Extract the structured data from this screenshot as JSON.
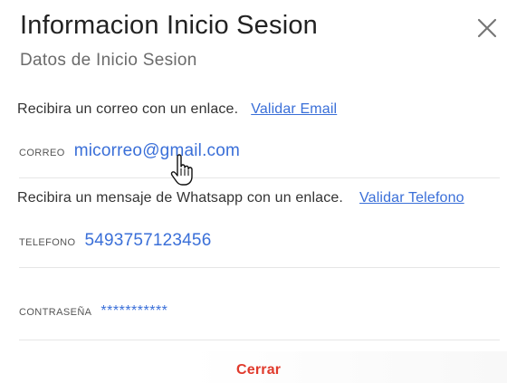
{
  "header": {
    "title": "Informacion Inicio Sesion",
    "subtitle": "Datos de Inicio Sesion",
    "close_icon": "close-icon"
  },
  "email_section": {
    "info_text": "Recibira un correo con un enlace.",
    "validate_link": "Validar Email",
    "label": "CORREO",
    "value": "micorreo@gmail.com"
  },
  "phone_section": {
    "info_text": "Recibira un mensaje de Whatsapp con un enlace.",
    "validate_link": "Validar Telefono",
    "label": "TELEFONO",
    "value": "5493757123456"
  },
  "password_section": {
    "label": "CONTRASEÑA",
    "value": "***********"
  },
  "footer": {
    "close_button": "Cerrar"
  },
  "colors": {
    "link": "#3a6fd8",
    "danger": "#e03a2c",
    "title": "#222222"
  }
}
